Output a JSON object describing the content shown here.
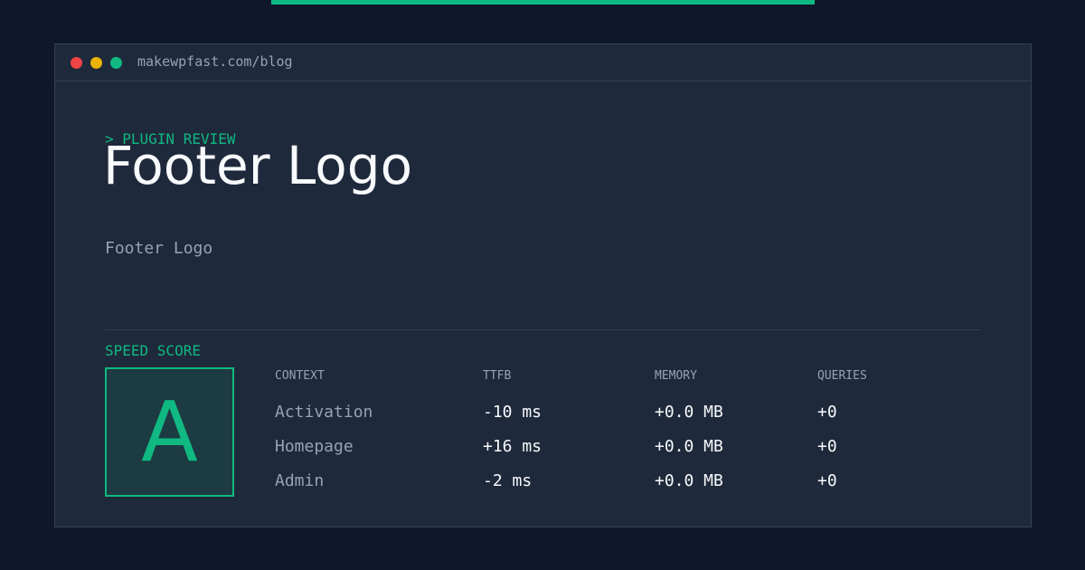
{
  "window": {
    "url": "makewpfast.com/blog"
  },
  "hero": {
    "eyebrow": "> PLUGIN REVIEW",
    "title": "Footer Logo",
    "subtitle": "Footer Logo"
  },
  "score": {
    "label": "SPEED SCORE",
    "grade": "A"
  },
  "table": {
    "headers": [
      "CONTEXT",
      "TTFB",
      "MEMORY",
      "QUERIES"
    ],
    "rows": [
      {
        "context": "Activation",
        "ttfb": "-10 ms",
        "memory": "+0.0 MB",
        "queries": "+0"
      },
      {
        "context": "Homepage",
        "ttfb": "+16 ms",
        "memory": "+0.0 MB",
        "queries": "+0"
      },
      {
        "context": "Admin",
        "ttfb": "-2 ms",
        "memory": "+0.0 MB",
        "queries": "+0"
      }
    ]
  },
  "colors": {
    "background": "#0f172a",
    "panel": "#1e293b",
    "accent": "#10b981",
    "text": "#f8fafc",
    "muted": "#94a3b8",
    "danger": "#ef4444",
    "warning": "#eab308"
  }
}
